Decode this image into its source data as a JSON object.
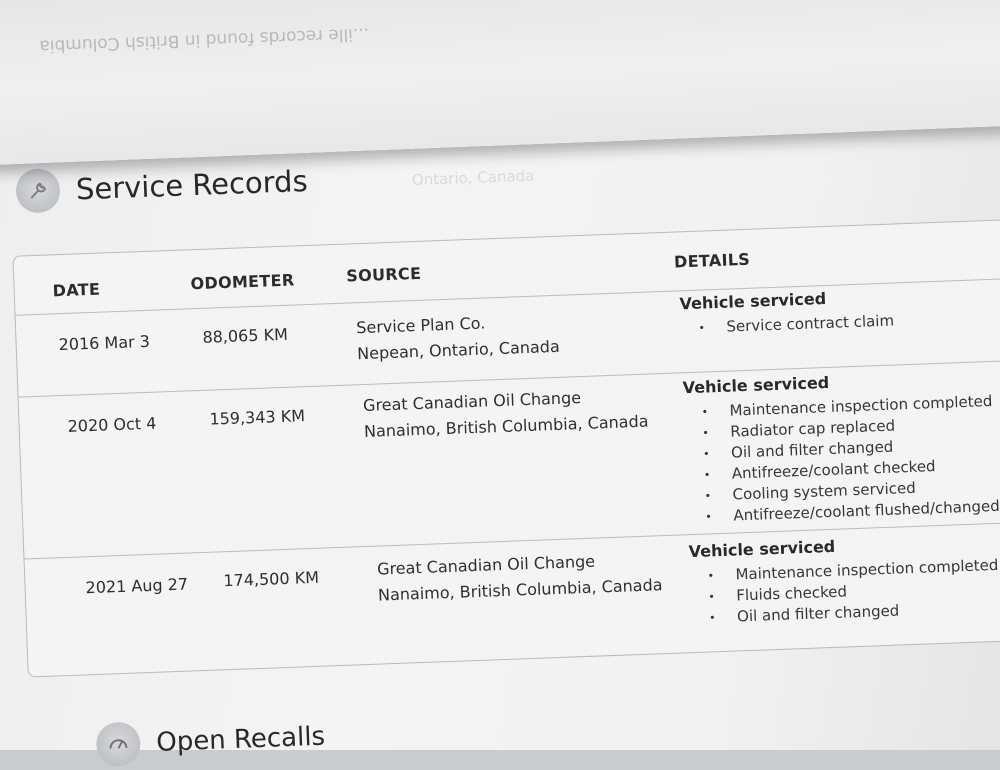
{
  "back_sheet_text": "...ille records found in British Columbia",
  "service_records": {
    "title": "Service Records",
    "headers": {
      "date": "DATE",
      "odometer": "ODOMETER",
      "source": "SOURCE",
      "details": "DETAILS"
    },
    "rows": [
      {
        "date": "2016 Mar 3",
        "odometer": "88,065 KM",
        "source_line1": "Service Plan Co.",
        "source_line2": "Nepean, Ontario, Canada",
        "details_title": "Vehicle serviced",
        "details": [
          "Service contract claim"
        ]
      },
      {
        "date": "2020 Oct 4",
        "odometer": "159,343 KM",
        "source_line1": "Great Canadian Oil Change",
        "source_line2": "Nanaimo, British Columbia, Canada",
        "details_title": "Vehicle serviced",
        "details": [
          "Maintenance inspection completed",
          "Radiator cap replaced",
          "Oil and filter changed",
          "Antifreeze/coolant checked",
          "Cooling system serviced",
          "Antifreeze/coolant flushed/changed"
        ]
      },
      {
        "date": "2021 Aug 27",
        "odometer": "174,500 KM",
        "source_line1": "Great Canadian Oil Change",
        "source_line2": "Nanaimo, British Columbia, Canada",
        "details_title": "Vehicle serviced",
        "details": [
          "Maintenance inspection completed",
          "Fluids checked",
          "Oil and filter changed"
        ]
      }
    ]
  },
  "open_recalls": {
    "title": "Open Recalls"
  },
  "icons": {
    "service": "wrench-icon",
    "recalls": "recall-gauge-icon"
  }
}
